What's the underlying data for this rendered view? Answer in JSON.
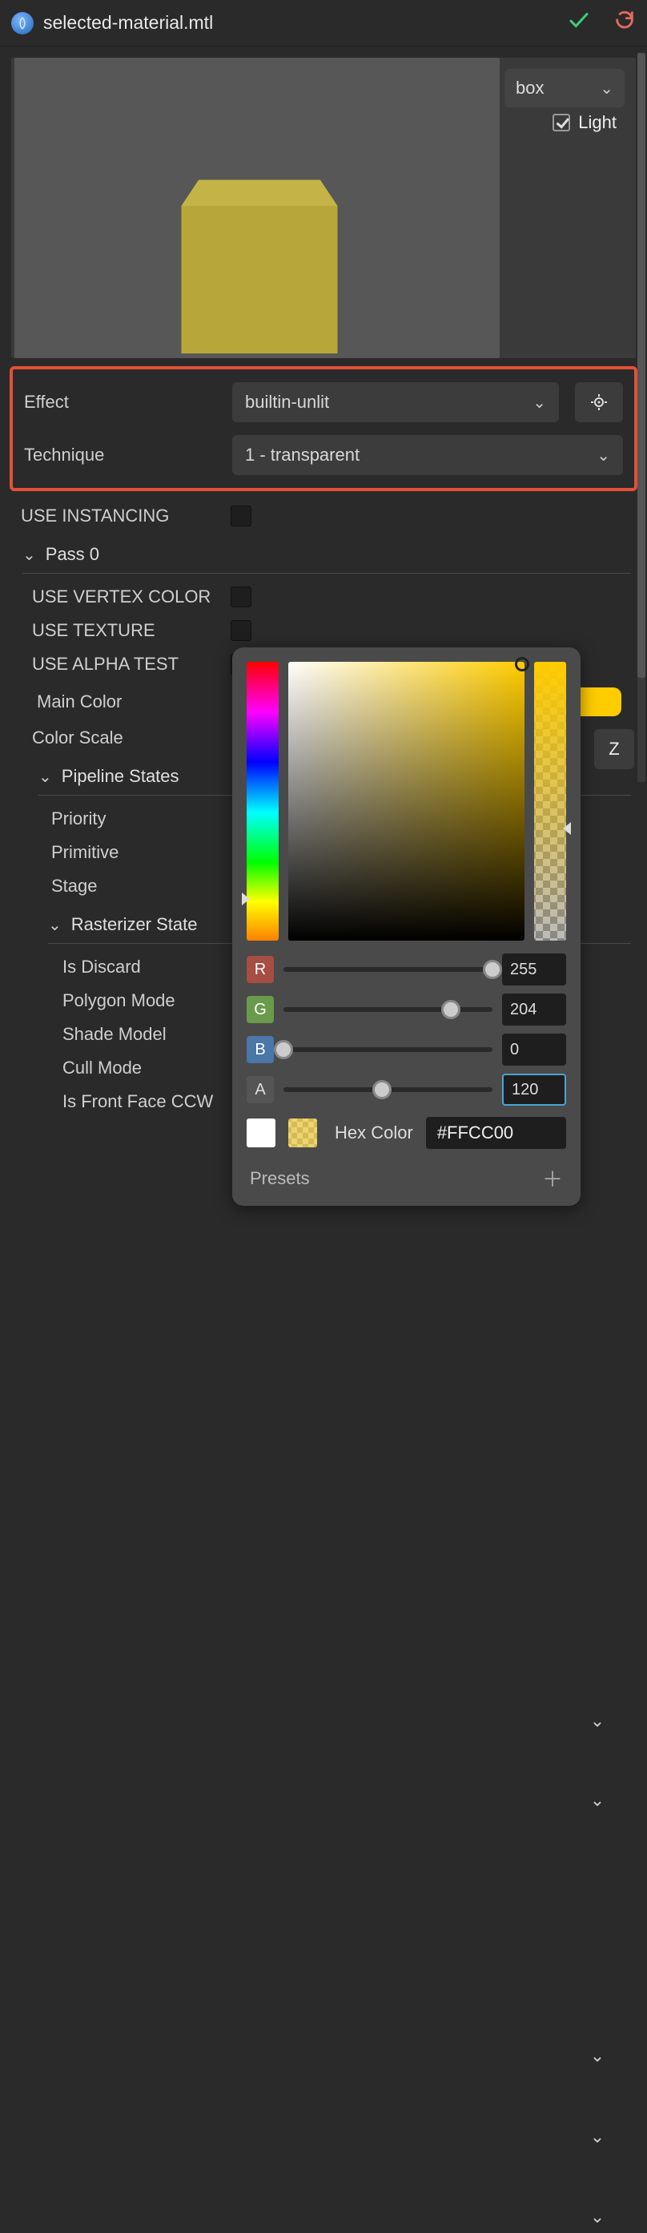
{
  "header": {
    "title": "selected-material.mtl"
  },
  "preview": {
    "shape_select": "box",
    "light_label": "Light",
    "light_checked": true
  },
  "effect": {
    "label": "Effect",
    "value": "builtin-unlit"
  },
  "technique": {
    "label": "Technique",
    "value": "1 - transparent"
  },
  "use_instancing": {
    "label": "USE INSTANCING"
  },
  "pass0": {
    "label": "Pass 0"
  },
  "use_vertex_color": {
    "label": "USE VERTEX COLOR"
  },
  "use_texture": {
    "label": "USE TEXTURE"
  },
  "use_alpha_test": {
    "label": "USE ALPHA TEST"
  },
  "main_color": {
    "label": "Main Color"
  },
  "color_scale": {
    "label": "Color Scale",
    "z": "Z"
  },
  "pipeline_states": {
    "label": "Pipeline States"
  },
  "priority": {
    "label": "Priority"
  },
  "primitive": {
    "label": "Primitive"
  },
  "stage": {
    "label": "Stage"
  },
  "rasterizer_state": {
    "label": "Rasterizer State"
  },
  "is_discard": {
    "label": "Is Discard"
  },
  "polygon_mode": {
    "label": "Polygon Mode"
  },
  "shade_model": {
    "label": "Shade Model"
  },
  "cull_mode": {
    "label": "Cull Mode"
  },
  "is_front_face_ccw": {
    "label": "Is Front Face CCW"
  },
  "color_picker": {
    "r_label": "R",
    "r_value": "255",
    "r_pct": 100,
    "g_label": "G",
    "g_value": "204",
    "g_pct": 80,
    "b_label": "B",
    "b_value": "0",
    "b_pct": 0,
    "a_label": "A",
    "a_value": "120",
    "a_pct": 47,
    "hex_label": "Hex Color",
    "hex_value": "#FFCC00",
    "presets_label": "Presets"
  }
}
